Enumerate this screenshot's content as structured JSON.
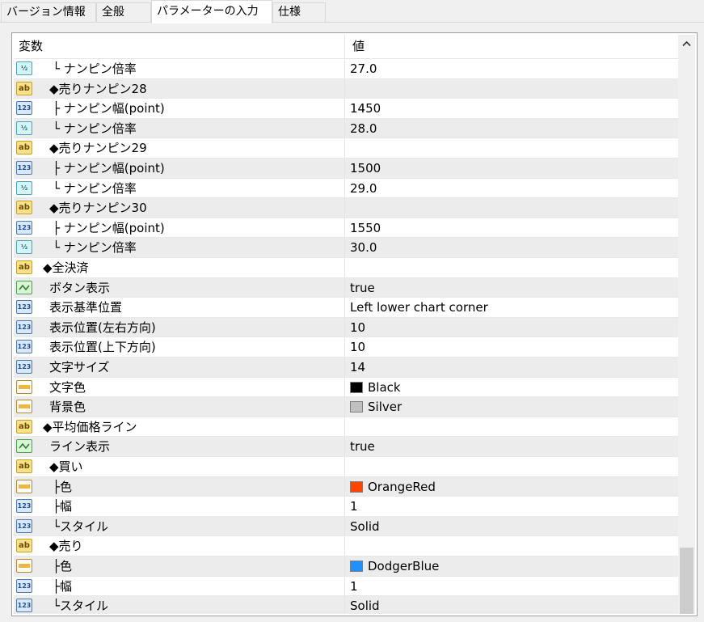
{
  "tabs": [
    {
      "label": "バージョン情報"
    },
    {
      "label": "全般"
    },
    {
      "label": "パラメーターの入力"
    },
    {
      "label": "仕様"
    }
  ],
  "header": {
    "col_name": "変数",
    "col_value": "値"
  },
  "rows": [
    {
      "icon": "v12",
      "name": "└ ナンピン倍率",
      "value": "27.0",
      "indent": 2
    },
    {
      "icon": "ab",
      "name": "◆売りナンピン28",
      "value": "",
      "indent": 1
    },
    {
      "icon": "i123",
      "name": "├ ナンピン幅(point)",
      "value": "1450",
      "indent": 2
    },
    {
      "icon": "v12",
      "name": "└ ナンピン倍率",
      "value": "28.0",
      "indent": 2
    },
    {
      "icon": "ab",
      "name": "◆売りナンピン29",
      "value": "",
      "indent": 1
    },
    {
      "icon": "i123",
      "name": "├ ナンピン幅(point)",
      "value": "1500",
      "indent": 2
    },
    {
      "icon": "v12",
      "name": "└ ナンピン倍率",
      "value": "29.0",
      "indent": 2
    },
    {
      "icon": "ab",
      "name": "◆売りナンピン30",
      "value": "",
      "indent": 1
    },
    {
      "icon": "i123",
      "name": "├ ナンピン幅(point)",
      "value": "1550",
      "indent": 2
    },
    {
      "icon": "v12",
      "name": "└ ナンピン倍率",
      "value": "30.0",
      "indent": 2
    },
    {
      "icon": "ab",
      "name": "◆全決済",
      "value": "",
      "indent": 0
    },
    {
      "icon": "bool",
      "name": "ボタン表示",
      "value": "true",
      "indent": 1
    },
    {
      "icon": "i123",
      "name": "表示基準位置",
      "value": "Left lower chart corner",
      "indent": 1
    },
    {
      "icon": "i123",
      "name": "表示位置(左右方向)",
      "value": "10",
      "indent": 1
    },
    {
      "icon": "i123",
      "name": "表示位置(上下方向)",
      "value": "10",
      "indent": 1
    },
    {
      "icon": "i123",
      "name": "文字サイズ",
      "value": "14",
      "indent": 1
    },
    {
      "icon": "color",
      "name": "文字色",
      "value": "Black",
      "swatch": "#000000",
      "indent": 1
    },
    {
      "icon": "color",
      "name": "背景色",
      "value": "Silver",
      "swatch": "#c0c0c0",
      "indent": 1
    },
    {
      "icon": "ab",
      "name": "◆平均価格ライン",
      "value": "",
      "indent": 0
    },
    {
      "icon": "bool",
      "name": "ライン表示",
      "value": "true",
      "indent": 1
    },
    {
      "icon": "ab",
      "name": "◆買い",
      "value": "",
      "indent": 1
    },
    {
      "icon": "color",
      "name": "├色",
      "value": "OrangeRed",
      "swatch": "#ff4500",
      "indent": 2
    },
    {
      "icon": "i123",
      "name": "├幅",
      "value": "1",
      "indent": 2
    },
    {
      "icon": "i123",
      "name": "└スタイル",
      "value": "Solid",
      "indent": 2
    },
    {
      "icon": "ab",
      "name": "◆売り",
      "value": "",
      "indent": 1
    },
    {
      "icon": "color",
      "name": "├色",
      "value": "DodgerBlue",
      "swatch": "#1e90ff",
      "indent": 2
    },
    {
      "icon": "i123",
      "name": "├幅",
      "value": "1",
      "indent": 2
    },
    {
      "icon": "i123",
      "name": "└スタイル",
      "value": "Solid",
      "indent": 2
    }
  ],
  "icons": {
    "ab": "string-type-icon",
    "i123": "integer-type-icon",
    "v12": "double-type-icon",
    "bool": "boolean-type-icon",
    "color": "color-type-icon"
  },
  "scrollbar": {
    "position": "bottom"
  }
}
